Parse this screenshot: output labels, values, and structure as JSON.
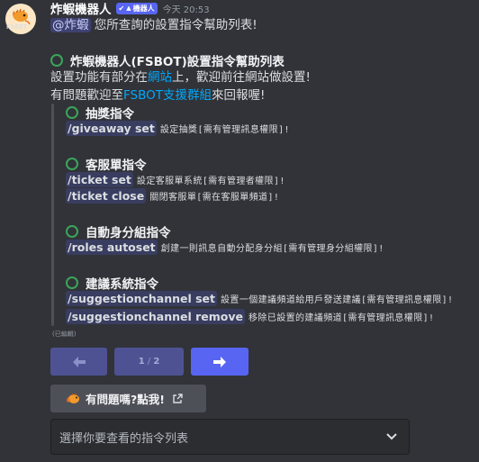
{
  "author": {
    "name": "炸蝦機器人",
    "badge": "機器人",
    "timestamp": "今天 20:53",
    "avatar_text": "FSBOT"
  },
  "message": {
    "mention": "@炸蝦",
    "text": " 您所查詢的設置指令幫助列表!"
  },
  "embed": {
    "title": "炸蝦機器人(FSBOT)設置指令幫助列表",
    "desc_line1_pre": "設置功能有部分在",
    "desc_line1_link": "網站",
    "desc_line1_post": "上，歡迎前往網站做設置!",
    "desc_line2_pre": "有問題歡迎至",
    "desc_line2_link": "FSBOT支援群組",
    "desc_line2_post": "來回報喔!",
    "sections": [
      {
        "title": "抽獎指令",
        "commands": [
          {
            "cmd": "/giveaway set",
            "desc": "設定抽獎[需有管理訊息權限]!"
          }
        ]
      },
      {
        "title": "客服單指令",
        "commands": [
          {
            "cmd": "/ticket set",
            "desc": "設定客服單系統[需有管理者權限]!"
          },
          {
            "cmd": "/ticket close",
            "desc": "關閉客服單[需在客服單頻道]!"
          }
        ]
      },
      {
        "title": "自動身分組指令",
        "commands": [
          {
            "cmd": "/roles autoset",
            "desc": "創建一則訊息自動分配身分組[需有管理身分組權限]!"
          }
        ]
      },
      {
        "title": "建議系統指令",
        "commands": [
          {
            "cmd": "/suggestionchannel set",
            "desc": "設置一個建議頻道給用戶發送建議[需有管理訊息權限]!"
          },
          {
            "cmd": "/suggestionchannel remove",
            "desc": "移除已設置的建議頻道[需有管理訊息權限]!"
          }
        ]
      }
    ],
    "edited": "(已編輯)"
  },
  "pagination": {
    "current": "1",
    "separator": "/",
    "total": "2",
    "prev_icon": "arrow-left-icon",
    "next_icon": "arrow-right-icon"
  },
  "help_button": {
    "label": "有問題嗎?點我!",
    "icon": "shrimp-icon"
  },
  "select_menu": {
    "placeholder": "選擇你要查看的指令列表"
  },
  "colors": {
    "background": "#313338",
    "blurple": "#5865f2",
    "link": "#00a8fc",
    "green_circle": "#3ba55c"
  }
}
